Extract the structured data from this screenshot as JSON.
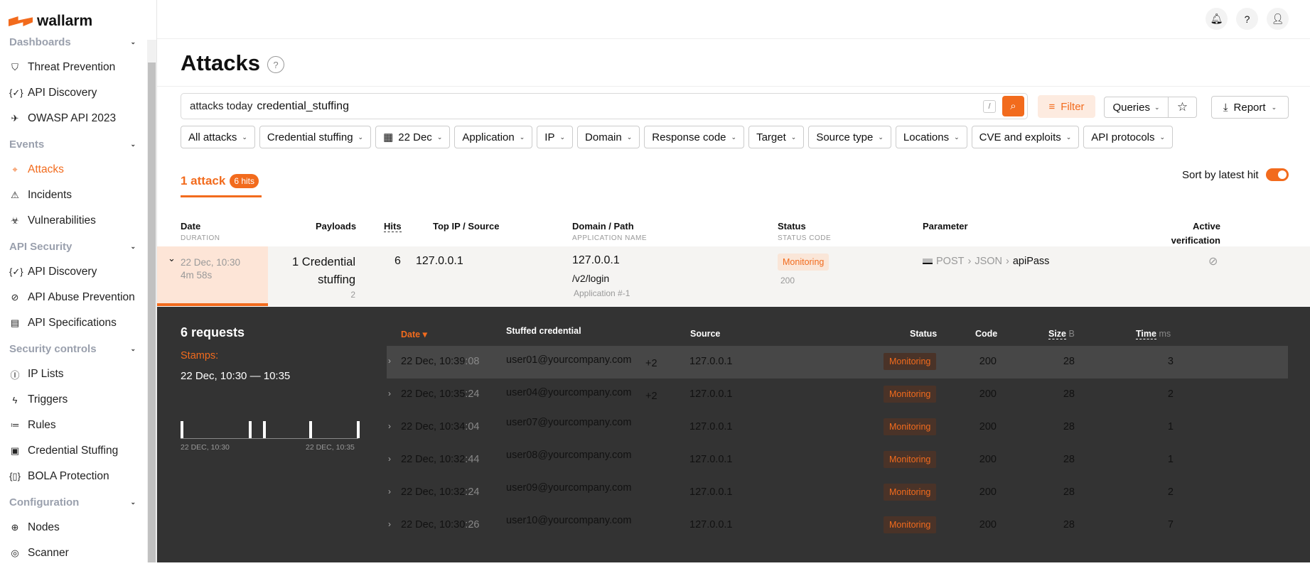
{
  "brand": "wallarm",
  "sidebar": {
    "sections": [
      {
        "title": "Dashboards",
        "items": [
          {
            "label": "Threat Prevention",
            "icon": "shield-bolt-icon"
          },
          {
            "label": "API Discovery",
            "icon": "braces-check-icon"
          },
          {
            "label": "OWASP API 2023",
            "icon": "plane-icon"
          }
        ]
      },
      {
        "title": "Events",
        "items": [
          {
            "label": "Attacks",
            "icon": "target-icon",
            "active": true
          },
          {
            "label": "Incidents",
            "icon": "warning-icon"
          },
          {
            "label": "Vulnerabilities",
            "icon": "biohazard-icon"
          }
        ]
      },
      {
        "title": "API Security",
        "items": [
          {
            "label": "API Discovery",
            "icon": "braces-check-icon"
          },
          {
            "label": "API Abuse Prevention",
            "icon": "robot-off-icon"
          },
          {
            "label": "API Specifications",
            "icon": "document-icon"
          }
        ]
      },
      {
        "title": "Security controls",
        "items": [
          {
            "label": "IP Lists",
            "icon": "ip-icon"
          },
          {
            "label": "Triggers",
            "icon": "bolt-icon"
          },
          {
            "label": "Rules",
            "icon": "rules-icon"
          },
          {
            "label": "Credential Stuffing",
            "icon": "id-card-icon"
          },
          {
            "label": "BOLA Protection",
            "icon": "id-braces-icon"
          }
        ]
      },
      {
        "title": "Configuration",
        "items": [
          {
            "label": "Nodes",
            "icon": "nodes-icon"
          },
          {
            "label": "Scanner",
            "icon": "scanner-icon"
          }
        ]
      }
    ]
  },
  "header": {
    "title": "Attacks"
  },
  "search": {
    "prefix": "attacks today",
    "value": "credential_stuffing",
    "shortcut": "/"
  },
  "toolbar": {
    "filter": "Filter",
    "queries": "Queries",
    "report": "Report"
  },
  "filters": [
    "All attacks",
    "Credential stuffing",
    "22 Dec",
    "Application",
    "IP",
    "Domain",
    "Response code",
    "Target",
    "Source type",
    "Locations",
    "CVE and exploits",
    "API protocols"
  ],
  "tab": {
    "count": "1 attack",
    "hits": "6 hits"
  },
  "sort": {
    "label": "Sort by latest hit",
    "enabled": true
  },
  "columns": {
    "date": "Date",
    "duration": "DURATION",
    "payloads": "Payloads",
    "hits": "Hits",
    "top_ip": "Top IP / Source",
    "domain": "Domain / Path",
    "app": "APPLICATION NAME",
    "status": "Status",
    "status_code": "STATUS CODE",
    "parameter": "Parameter",
    "active": "Active",
    "verification": "verification"
  },
  "attack": {
    "date": "22 Dec, 10:30",
    "duration": "4m 58s",
    "payload": "1 Credential",
    "payload2": "stuffing",
    "payload_count": "2",
    "hits": "6",
    "ip": "127.0.0.1",
    "domain": "127.0.0.1",
    "path": "/v2/login",
    "app": "Application #-1",
    "status": "Monitoring",
    "code": "200",
    "param_method": "POST",
    "param_fmt": "JSON",
    "param_name": "apiPass"
  },
  "details": {
    "title": "6 requests",
    "stamps_label": "Stamps:",
    "stamps": "22 Dec, 10:30 — 10:35",
    "axis_start": "22 DEC, 10:30",
    "axis_end": "22 DEC, 10:35",
    "cols": {
      "date": "Date",
      "cred": "Stuffed credential",
      "source": "Source",
      "status": "Status",
      "code": "Code",
      "size": "Size",
      "size_unit": "B",
      "time": "Time",
      "time_unit": "ms"
    },
    "requests": [
      {
        "date": "22 Dec, 10:39",
        "sec": ":08",
        "cred": "user01@yourcompany.com",
        "more": "+2",
        "source": "127.0.0.1",
        "status": "Monitoring",
        "code": "200",
        "size": "28",
        "time": "3"
      },
      {
        "date": "22 Dec, 10:35",
        "sec": ":24",
        "cred": "user04@yourcompany.com",
        "more": "+2",
        "source": "127.0.0.1",
        "status": "Monitoring",
        "code": "200",
        "size": "28",
        "time": "2"
      },
      {
        "date": "22 Dec, 10:34",
        "sec": ":04",
        "cred": "user07@yourcompany.com",
        "more": "",
        "source": "127.0.0.1",
        "status": "Monitoring",
        "code": "200",
        "size": "28",
        "time": "1"
      },
      {
        "date": "22 Dec, 10:32",
        "sec": ":44",
        "cred": "user08@yourcompany.com",
        "more": "",
        "source": "127.0.0.1",
        "status": "Monitoring",
        "code": "200",
        "size": "28",
        "time": "1"
      },
      {
        "date": "22 Dec, 10:32",
        "sec": ":24",
        "cred": "user09@yourcompany.com",
        "more": "",
        "source": "127.0.0.1",
        "status": "Monitoring",
        "code": "200",
        "size": "28",
        "time": "2"
      },
      {
        "date": "22 Dec, 10:30",
        "sec": ":26",
        "cred": "user10@yourcompany.com",
        "more": "",
        "source": "127.0.0.1",
        "status": "Monitoring",
        "code": "200",
        "size": "28",
        "time": "7"
      }
    ]
  },
  "accent": "#f26b1d"
}
